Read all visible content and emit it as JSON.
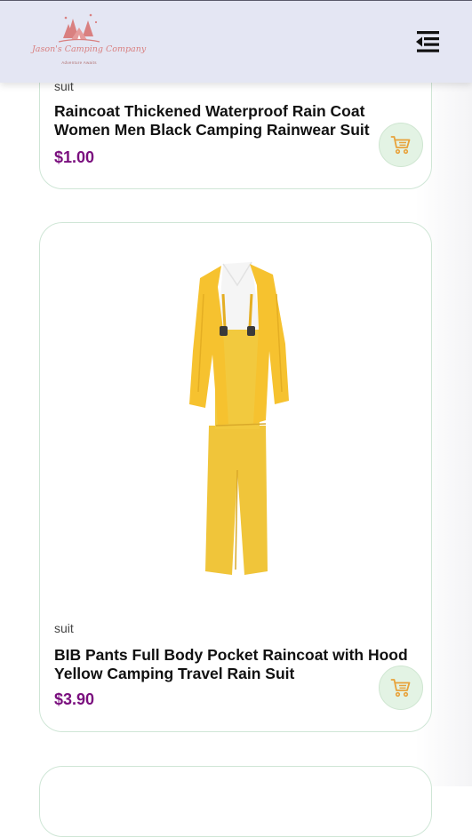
{
  "header": {
    "logo": {
      "name": "Jason's Camping Company",
      "tagline": "Adventure Awaits"
    },
    "menu_icon": "menu-toggle-icon"
  },
  "products": [
    {
      "category": "suit",
      "title": "Raincoat Thickened Waterproof Rain Coat Women Men Black Camping Rainwear Suit",
      "price": "$1.00",
      "cart_icon": "shopping-cart-icon"
    },
    {
      "category": "suit",
      "title": "BIB Pants Full Body Pocket Raincoat with Hood Yellow Camping Travel Rain Suit",
      "price": "$3.90",
      "image": "yellow-rain-suit-image",
      "cart_icon": "shopping-cart-icon"
    }
  ],
  "colors": {
    "header_bg": "#e4e6f3",
    "price": "#7a0f7e",
    "cart_button_bg": "#e3f3e4",
    "cart_icon": "#e8a23a",
    "card_border": "#cfe6d6",
    "logo": "#d98080"
  }
}
